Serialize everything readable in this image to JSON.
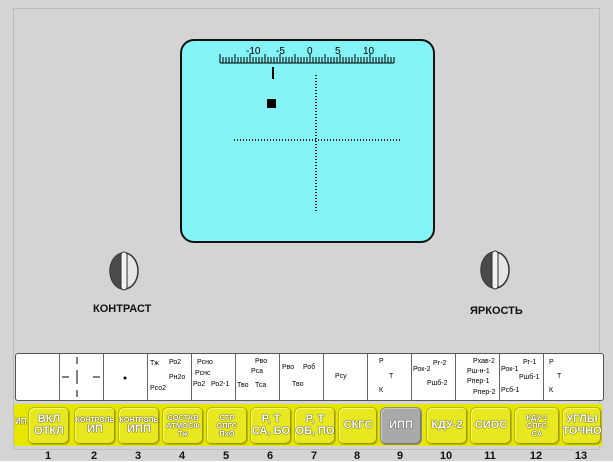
{
  "display": {
    "scale_labels": [
      "-10",
      "-5",
      "0",
      "5",
      "10"
    ]
  },
  "knobs": {
    "contrast_label": "КОНТРАСТ",
    "brightness_label": "ЯРКОСТЬ"
  },
  "strip_cells": {
    "cell4": [
      "Тж",
      "Ро2",
      "Рн2о",
      "Рсо2"
    ],
    "cell5": [
      "Рсно",
      "Рснс",
      "Ро2",
      "Ро2-1"
    ],
    "cell6": [
      "Рво",
      "Рса",
      "Тво",
      "Тса"
    ],
    "cell7": [
      "Рво",
      "Роб",
      "Тво"
    ],
    "cell8": [
      "Рсу"
    ],
    "cell9": [
      "Р",
      "Т",
      "К"
    ],
    "cell10": [
      "Рок-2",
      "Рг-2",
      "Ршб-2"
    ],
    "cell11": [
      "Рхав-2",
      "Рш-н-1",
      "Рпер-1",
      "Рпер-2"
    ],
    "cell12": [
      "Рок-1",
      "Рг-1",
      "Ршб-1",
      "Рсб-1"
    ],
    "cell13": [
      "Р",
      "Т",
      "К"
    ]
  },
  "buttons": [
    {
      "n": "1",
      "prefix": "ИП",
      "lines": [
        "ВКЛ",
        "ОТКЛ"
      ]
    },
    {
      "n": "2",
      "lines": [
        "КОНТРОЛЬ",
        "ИП"
      ]
    },
    {
      "n": "3",
      "lines": [
        "КОНТРОЛЬ",
        "ИПП"
      ]
    },
    {
      "n": "4",
      "lines": [
        "СОСТАВ",
        "АТМОСФ",
        "Тж"
      ]
    },
    {
      "n": "5",
      "lines": [
        "СТР",
        "СПГС",
        "ПхО"
      ]
    },
    {
      "n": "6",
      "lines": [
        "Р, Т",
        "СА, БО"
      ]
    },
    {
      "n": "7",
      "lines": [
        "Р, Т",
        "ОБ, ПО"
      ]
    },
    {
      "n": "8",
      "lines": [
        "СКГС"
      ]
    },
    {
      "n": "9",
      "lines": [
        "ИПП"
      ],
      "active": true
    },
    {
      "n": "10",
      "lines": [
        "КДУ-2"
      ]
    },
    {
      "n": "11",
      "lines": [
        "СИОС"
      ]
    },
    {
      "n": "12",
      "lines": [
        "КДУ-1",
        "СПГС",
        "СА"
      ]
    },
    {
      "n": "13",
      "lines": [
        "УГЛЫ",
        "ТОЧНО"
      ]
    }
  ],
  "colors": {
    "screen": "#83f3f5",
    "panel": "#d4d4d4",
    "button_yellow": "#e8e821",
    "button_active": "#a9a9a9"
  }
}
